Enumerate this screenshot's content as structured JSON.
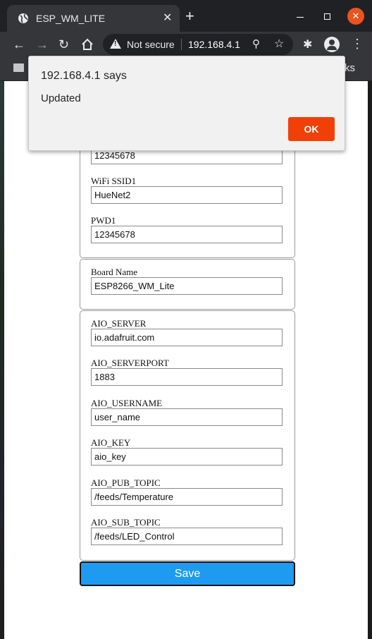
{
  "browser": {
    "tab_title": "ESP_WM_LITE",
    "new_tab_label": "+",
    "security_label": "Not secure",
    "url": "192.168.4.1",
    "bookmarks_tail": "rks"
  },
  "dialog": {
    "title": "192.168.4.1 says",
    "message": "Updated",
    "ok_label": "OK"
  },
  "form": {
    "top_partial_value": "12345678",
    "wifi": [
      {
        "label": "WiFi SSID1",
        "value": "HueNet2"
      },
      {
        "label": "PWD1",
        "value": "12345678"
      }
    ],
    "board": {
      "label": "Board Name",
      "value": "ESP8266_WM_Lite"
    },
    "aio": [
      {
        "label": "AIO_SERVER",
        "value": "io.adafruit.com"
      },
      {
        "label": "AIO_SERVERPORT",
        "value": "1883"
      },
      {
        "label": "AIO_USERNAME",
        "value": "user_name"
      },
      {
        "label": "AIO_KEY",
        "value": "aio_key"
      },
      {
        "label": "AIO_PUB_TOPIC",
        "value": "/feeds/Temperature"
      },
      {
        "label": "AIO_SUB_TOPIC",
        "value": "/feeds/LED_Control"
      }
    ],
    "save_label": "Save"
  },
  "colors": {
    "save_button": "#1e9bf0",
    "ok_button": "#f04008",
    "window_close": "#e95420"
  }
}
